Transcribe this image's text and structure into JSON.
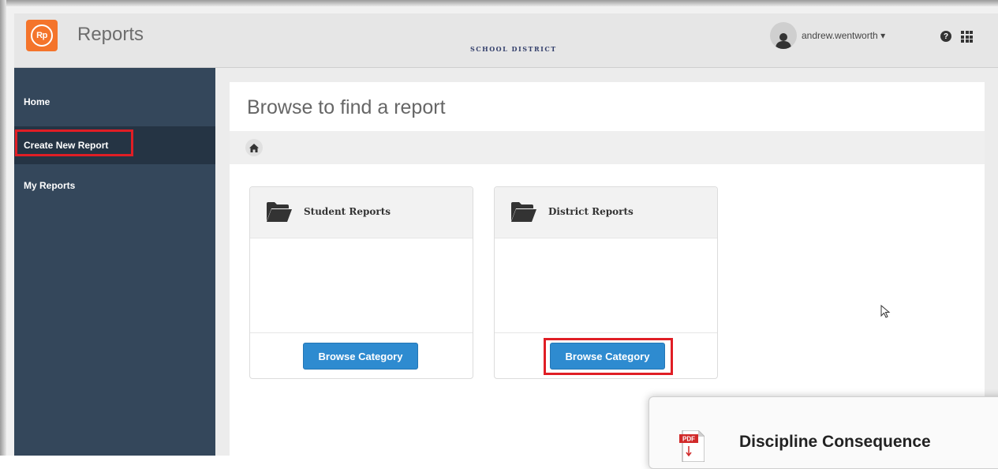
{
  "header": {
    "logo_text": "Rp",
    "app_title": "Reports",
    "district_label": "SCHOOL DISTRICT",
    "user_name": "andrew.wentworth",
    "user_caret": "▾",
    "help_glyph": "?"
  },
  "sidebar": {
    "items": [
      {
        "label": "Home"
      },
      {
        "label": "Create New Report"
      },
      {
        "label": "My Reports"
      }
    ]
  },
  "main": {
    "title": "Browse to find a report",
    "cards": [
      {
        "title": "Student Reports",
        "button": "Browse Category"
      },
      {
        "title": "District Reports",
        "button": "Browse Category"
      }
    ]
  },
  "overlay": {
    "icon_label": "PDF",
    "title": "Discipline Consequence"
  },
  "colors": {
    "sidebar": "#34475b",
    "accent_orange": "#f4742b",
    "button_blue": "#2e8bd0",
    "highlight_red": "#e01e25"
  }
}
